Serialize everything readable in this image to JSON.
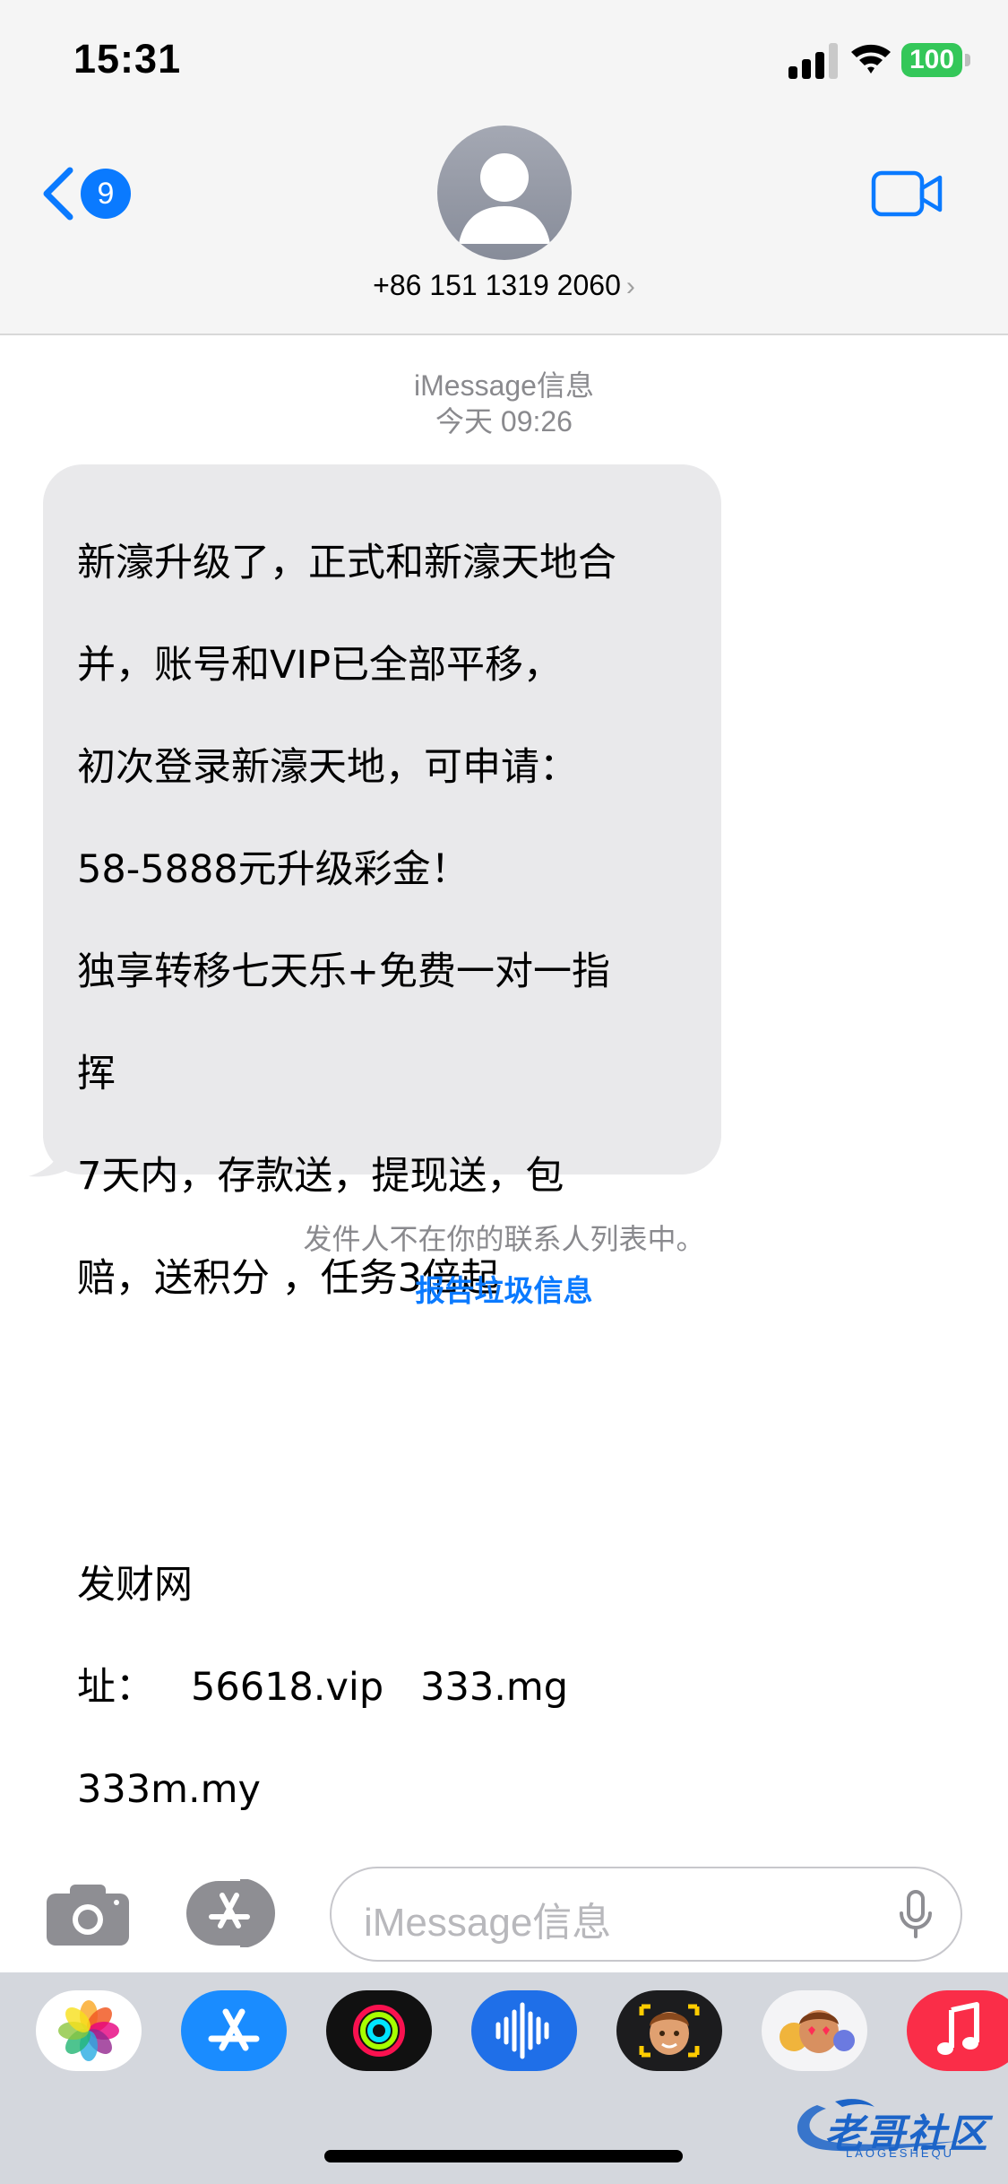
{
  "status_bar": {
    "time": "15:31",
    "battery": "100"
  },
  "header": {
    "back_badge": "9",
    "contact": "+86 151 1319 2060",
    "contact_chevron": "›"
  },
  "conversation": {
    "service": "iMessage信息",
    "timestamp": "今天 09:26",
    "message_lines": [
      "新濠升级了，正式和新濠天地合",
      "并，账号和VIP已全部平移，",
      "初次登录新濠天地，可申请：",
      "58-5888元升级彩金！",
      "独享转移七天乐+免费一对一指",
      "挥",
      "7天内，存款送，提现送，包",
      "赔，送积分 ，任务3倍起",
      "",
      "",
      "发财网",
      "址：   56618.vip   333.mg",
      "333m.my"
    ],
    "not_in_contacts": "发件人不在你的联系人列表中。",
    "report_junk": "报告垃圾信息"
  },
  "composer": {
    "placeholder": "iMessage信息"
  },
  "app_drawer": {
    "apps": [
      "photos-app",
      "app-store-app",
      "activity-app",
      "voice-memos-app",
      "memoji-app",
      "animoji-stickers-app",
      "music-app"
    ]
  },
  "watermark": {
    "text": "老哥社区",
    "sub": "LAOGESHEQU"
  },
  "colors": {
    "accent": "#0a7aff",
    "bubble": "#e9e9eb",
    "battery": "#34c759"
  }
}
